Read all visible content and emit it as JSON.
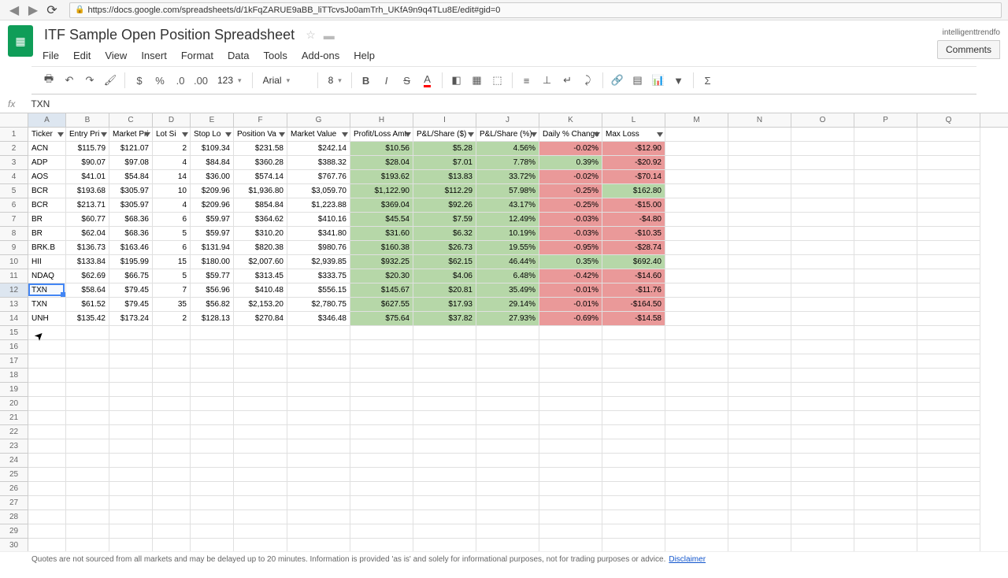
{
  "browser": {
    "url": "https://docs.google.com/spreadsheets/d/1kFqZARUE9aBB_liTTcvsJo0amTrh_UKfA9n9q4TLu8E/edit#gid=0"
  },
  "doc": {
    "title": "ITF Sample Open Position Spreadsheet",
    "user_label": "intelligenttrendfo",
    "comments_btn": "Comments"
  },
  "menu": [
    "File",
    "Edit",
    "View",
    "Insert",
    "Format",
    "Data",
    "Tools",
    "Add-ons",
    "Help"
  ],
  "toolbar": {
    "font": "Arial",
    "font_size": "8",
    "number_format": "123"
  },
  "formula": {
    "fx": "fx",
    "value": "TXN"
  },
  "columns": [
    "A",
    "B",
    "C",
    "D",
    "E",
    "F",
    "G",
    "H",
    "I",
    "J",
    "K",
    "L",
    "M",
    "N",
    "O",
    "P",
    "Q"
  ],
  "col_widths": [
    "cA",
    "cB",
    "cC",
    "cD",
    "cE",
    "cF",
    "cG",
    "cH",
    "cI",
    "cJ",
    "cK",
    "cL",
    "cM",
    "cN",
    "cO",
    "cP",
    "cQ"
  ],
  "headers": [
    {
      "label": "Ticker",
      "filter": true
    },
    {
      "label": "Entry Pri",
      "filter": true
    },
    {
      "label": "Market Pri",
      "filter": true
    },
    {
      "label": "Lot Si",
      "filter": true
    },
    {
      "label": "Stop Lo",
      "filter": true
    },
    {
      "label": "Position Va",
      "filter": true
    },
    {
      "label": "Market Value",
      "filter": true
    },
    {
      "label": "Profit/Loss Amt",
      "filter": true
    },
    {
      "label": "P&L/Share ($)",
      "filter": true
    },
    {
      "label": "P&L/Share (%)",
      "filter": true
    },
    {
      "label": "Daily % Change",
      "filter": true
    },
    {
      "label": "Max Loss",
      "filter": true
    }
  ],
  "data_rows": [
    {
      "ticker": "ACN",
      "entry": "$115.79",
      "market": "$121.07",
      "lot": "2",
      "stop": "$109.34",
      "posval": "$231.58",
      "mktval": "$242.14",
      "plamt": "$10.56",
      "plsh": "$5.28",
      "plpct": "4.56%",
      "daily": "-0.02%",
      "daily_down": true,
      "maxloss": "-$12.90"
    },
    {
      "ticker": "ADP",
      "entry": "$90.07",
      "market": "$97.08",
      "lot": "4",
      "stop": "$84.84",
      "posval": "$360.28",
      "mktval": "$388.32",
      "plamt": "$28.04",
      "plsh": "$7.01",
      "plpct": "7.78%",
      "daily": "0.39%",
      "daily_down": false,
      "maxloss": "-$20.92"
    },
    {
      "ticker": "AOS",
      "entry": "$41.01",
      "market": "$54.84",
      "lot": "14",
      "stop": "$36.00",
      "posval": "$574.14",
      "mktval": "$767.76",
      "plamt": "$193.62",
      "plsh": "$13.83",
      "plpct": "33.72%",
      "daily": "-0.02%",
      "daily_down": true,
      "maxloss": "-$70.14"
    },
    {
      "ticker": "BCR",
      "entry": "$193.68",
      "market": "$305.97",
      "lot": "10",
      "stop": "$209.96",
      "posval": "$1,936.80",
      "mktval": "$3,059.70",
      "plamt": "$1,122.90",
      "plsh": "$112.29",
      "plpct": "57.98%",
      "daily": "-0.25%",
      "daily_down": true,
      "maxloss": "$162.80",
      "maxloss_pos": true
    },
    {
      "ticker": "BCR",
      "entry": "$213.71",
      "market": "$305.97",
      "lot": "4",
      "stop": "$209.96",
      "posval": "$854.84",
      "mktval": "$1,223.88",
      "plamt": "$369.04",
      "plsh": "$92.26",
      "plpct": "43.17%",
      "daily": "-0.25%",
      "daily_down": true,
      "maxloss": "-$15.00"
    },
    {
      "ticker": "BR",
      "entry": "$60.77",
      "market": "$68.36",
      "lot": "6",
      "stop": "$59.97",
      "posval": "$364.62",
      "mktval": "$410.16",
      "plamt": "$45.54",
      "plsh": "$7.59",
      "plpct": "12.49%",
      "daily": "-0.03%",
      "daily_down": true,
      "maxloss": "-$4.80"
    },
    {
      "ticker": "BR",
      "entry": "$62.04",
      "market": "$68.36",
      "lot": "5",
      "stop": "$59.97",
      "posval": "$310.20",
      "mktval": "$341.80",
      "plamt": "$31.60",
      "plsh": "$6.32",
      "plpct": "10.19%",
      "daily": "-0.03%",
      "daily_down": true,
      "maxloss": "-$10.35"
    },
    {
      "ticker": "BRK.B",
      "entry": "$136.73",
      "market": "$163.46",
      "lot": "6",
      "stop": "$131.94",
      "posval": "$820.38",
      "mktval": "$980.76",
      "plamt": "$160.38",
      "plsh": "$26.73",
      "plpct": "19.55%",
      "daily": "-0.95%",
      "daily_down": true,
      "maxloss": "-$28.74"
    },
    {
      "ticker": "HII",
      "entry": "$133.84",
      "market": "$195.99",
      "lot": "15",
      "stop": "$180.00",
      "posval": "$2,007.60",
      "mktval": "$2,939.85",
      "plamt": "$932.25",
      "plsh": "$62.15",
      "plpct": "46.44%",
      "daily": "0.35%",
      "daily_down": false,
      "maxloss": "$692.40",
      "maxloss_pos": true
    },
    {
      "ticker": "NDAQ",
      "entry": "$62.69",
      "market": "$66.75",
      "lot": "5",
      "stop": "$59.77",
      "posval": "$313.45",
      "mktval": "$333.75",
      "plamt": "$20.30",
      "plsh": "$4.06",
      "plpct": "6.48%",
      "daily": "-0.42%",
      "daily_down": true,
      "maxloss": "-$14.60"
    },
    {
      "ticker": "TXN",
      "entry": "$58.64",
      "market": "$79.45",
      "lot": "7",
      "stop": "$56.96",
      "posval": "$410.48",
      "mktval": "$556.15",
      "plamt": "$145.67",
      "plsh": "$20.81",
      "plpct": "35.49%",
      "daily": "-0.01%",
      "daily_down": true,
      "maxloss": "-$11.76"
    },
    {
      "ticker": "TXN",
      "entry": "$61.52",
      "market": "$79.45",
      "lot": "35",
      "stop": "$56.82",
      "posval": "$2,153.20",
      "mktval": "$2,780.75",
      "plamt": "$627.55",
      "plsh": "$17.93",
      "plpct": "29.14%",
      "daily": "-0.01%",
      "daily_down": true,
      "maxloss": "-$164.50"
    },
    {
      "ticker": "UNH",
      "entry": "$135.42",
      "market": "$173.24",
      "lot": "2",
      "stop": "$128.13",
      "posval": "$270.84",
      "mktval": "$346.48",
      "plamt": "$75.64",
      "plsh": "$37.82",
      "plpct": "27.93%",
      "daily": "-0.69%",
      "daily_down": true,
      "maxloss": "-$14.58"
    }
  ],
  "selected_row": 12,
  "footer": {
    "text": "Quotes are not sourced from all markets and may be delayed up to 20 minutes. Information is provided 'as is' and solely for informational purposes, not for trading purposes or advice.",
    "link": "Disclaimer"
  }
}
